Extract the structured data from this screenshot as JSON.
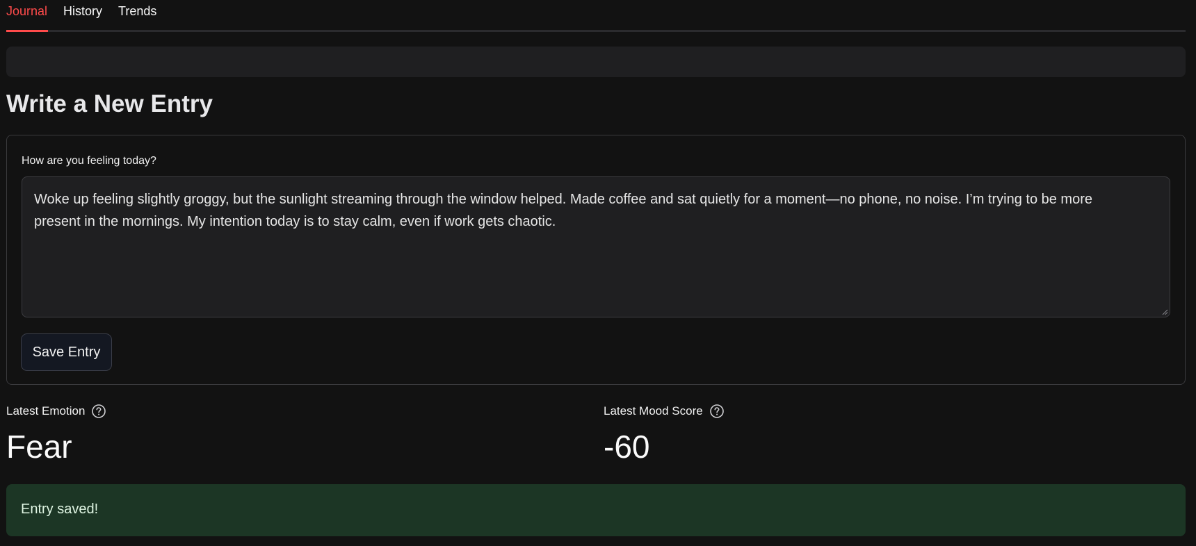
{
  "tabs": [
    {
      "label": "Journal",
      "active": true
    },
    {
      "label": "History",
      "active": false
    },
    {
      "label": "Trends",
      "active": false
    }
  ],
  "colors": {
    "background": "#121212",
    "accent": "#ff4b4b",
    "success_bg": "#1c3625"
  },
  "main": {
    "title": "Write a New Entry",
    "form": {
      "label": "How are you feeling today?",
      "entry_text": "Woke up feeling slightly groggy, but the sunlight streaming through the window helped. Made coffee and sat quietly for a moment—no phone, no noise. I’m trying to be more present in the mornings. My intention today is to stay calm, even if work gets chaotic.",
      "save_label": "Save Entry"
    },
    "metrics": [
      {
        "label": "Latest Emotion",
        "value": "Fear",
        "icon": "help-circle-icon"
      },
      {
        "label": "Latest Mood Score",
        "value": "-60",
        "icon": "help-circle-icon"
      }
    ],
    "alert": {
      "message": "Entry saved!"
    }
  }
}
